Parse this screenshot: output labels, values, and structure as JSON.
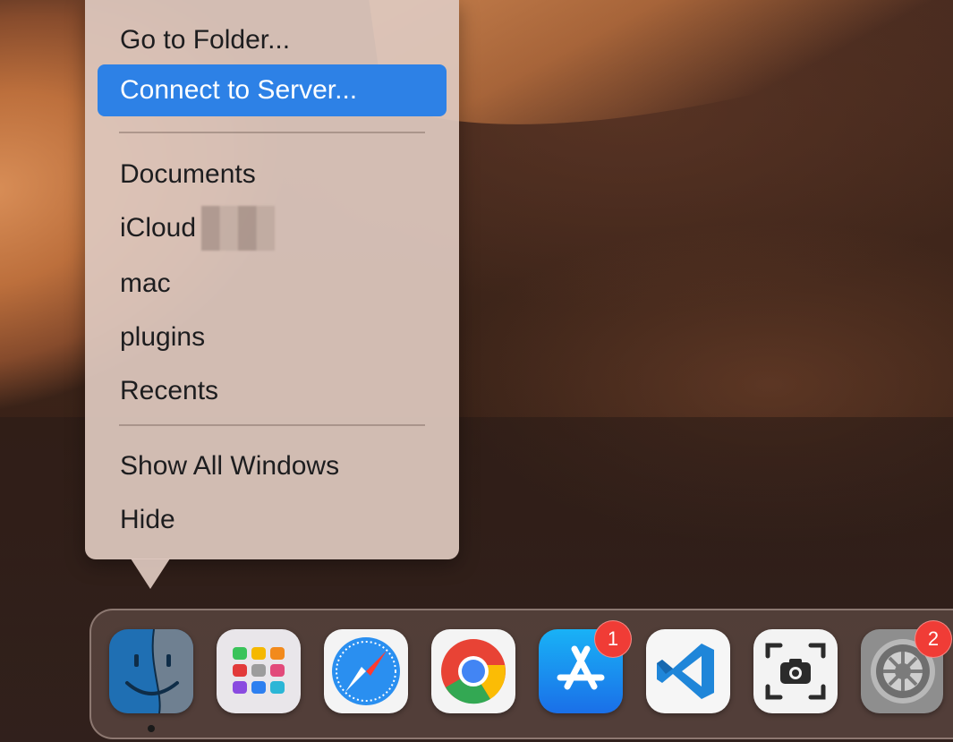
{
  "context_menu": {
    "items": [
      {
        "label": "Go to Folder...",
        "highlighted": false
      },
      {
        "label": "Connect to Server...",
        "highlighted": true
      },
      {
        "label": "Documents",
        "highlighted": false
      },
      {
        "label": "iCloud",
        "highlighted": false
      },
      {
        "label": "mac",
        "highlighted": false
      },
      {
        "label": "plugins",
        "highlighted": false
      },
      {
        "label": "Recents",
        "highlighted": false
      },
      {
        "label": "Show All Windows",
        "highlighted": false
      },
      {
        "label": "Hide",
        "highlighted": false
      }
    ],
    "highlight_color": "#2d81e6"
  },
  "dock": {
    "apps": [
      {
        "name": "Finder",
        "icon": "finder-icon",
        "running": true
      },
      {
        "name": "Launchpad",
        "icon": "launchpad-icon"
      },
      {
        "name": "Safari",
        "icon": "safari-icon"
      },
      {
        "name": "Google Chrome",
        "icon": "chrome-icon"
      },
      {
        "name": "App Store",
        "icon": "app-store-icon",
        "badge": "1"
      },
      {
        "name": "Visual Studio Code",
        "icon": "vscode-icon"
      },
      {
        "name": "Screenshot",
        "icon": "screenshot-icon"
      },
      {
        "name": "System Preferences",
        "icon": "system-preferences-icon",
        "badge": "2"
      }
    ],
    "badge_color": "#f03c36"
  }
}
